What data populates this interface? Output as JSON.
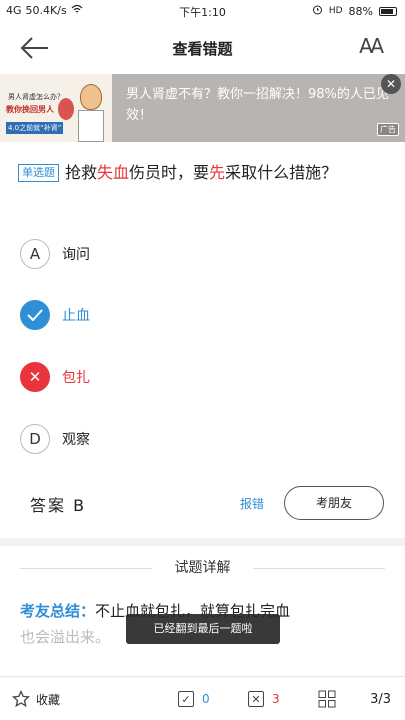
{
  "status_bar": {
    "signal": "4G",
    "speed": "50.4K/s",
    "time": "下午1:10",
    "battery": "88%",
    "battery_level": 0.88
  },
  "header": {
    "title": "查看错题",
    "font_size_label": "AA"
  },
  "ad": {
    "thumb_line1": "男人肾虚怎么办？",
    "thumb_line2": "教你挽回男人",
    "thumb_line3": "4.0之前就“补肾”",
    "text": "男人肾虚不有？教你一招解决！98%的人已见效！",
    "tag": "广告",
    "close": "✕"
  },
  "question": {
    "type": "单选题",
    "parts": [
      {
        "text": "抢救",
        "red": false
      },
      {
        "text": "失血",
        "red": true
      },
      {
        "text": "伤员时，要",
        "red": false
      },
      {
        "text": "先",
        "red": true
      },
      {
        "text": "采取什么措施？",
        "red": false
      }
    ]
  },
  "options": [
    {
      "key": "A",
      "label": "询问",
      "state": "normal"
    },
    {
      "key": "✓",
      "label": "止血",
      "state": "correct"
    },
    {
      "key": "✕",
      "label": "包扎",
      "state": "wrong"
    },
    {
      "key": "D",
      "label": "观察",
      "state": "normal"
    }
  ],
  "answer": {
    "text": "答案 B",
    "report": "报错",
    "ask": "考朋友"
  },
  "detail": {
    "header": "试题详解",
    "label": "考友总结：",
    "text": "不止血就包扎，就算包扎完血",
    "faded_text": "也会溢出来。"
  },
  "toast": "已经翻到最后一题啦",
  "bottom_bar": {
    "fav_label": "收藏",
    "right_count": "0",
    "wrong_count": "3",
    "pager": "3/3"
  },
  "colors": {
    "accent": "#2f8fd6",
    "error": "#e8343c"
  }
}
